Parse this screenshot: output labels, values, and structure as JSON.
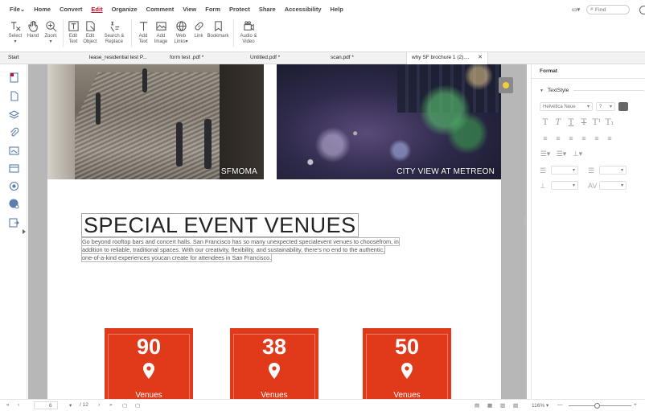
{
  "menu": {
    "items": [
      "File",
      "Home",
      "Convert",
      "Edit",
      "Organize",
      "Comment",
      "View",
      "Form",
      "Protect",
      "Share",
      "Accessibility",
      "Help"
    ],
    "active": "Edit",
    "find_placeholder": "Find"
  },
  "toolbar": {
    "select": "Select\n▾",
    "hand": "Hand",
    "zoom": "Zoom\n▾",
    "edit_text": "Edit\nText",
    "edit_object": "Edit\nObject",
    "search_replace": "Search &\nReplace",
    "add_text": "Add\nText",
    "add_image": "Add\nImage",
    "web_links": "Web\nLinks▾",
    "link": "Link",
    "bookmark": "Bookmark",
    "audio_video": "Audio &\nVideo"
  },
  "tabs": [
    "Start",
    "lease_residential test P...",
    "form test .pdf *",
    "Untitled.pdf *",
    "scan.pdf *",
    "why SF brochure 1 (2)...."
  ],
  "active_tab_index": 5,
  "document": {
    "photo_captions": [
      "SFMOMA",
      "CITY VIEW AT METREON"
    ],
    "headline": "SPECIAL EVENT VENUES",
    "body_lines": [
      "Go beyond rooftop bars and concert halls. San Francisco has so many unexpected specialevent venues to choosefrom, in",
      "addition to reliable, traditional spaces. With our creativity, flexibility, and sustainability, there's no end to the authentic,",
      "one-of-a-kind experiences youcan create for attendees in San Francisco."
    ],
    "stats": [
      {
        "number": "90",
        "label": "Venues"
      },
      {
        "number": "38",
        "label": "Venues"
      },
      {
        "number": "50",
        "label": "Venues"
      }
    ],
    "stat_color": "#e13a1a"
  },
  "right_panel": {
    "tab": "Format",
    "section": "TextStyle",
    "font": "Helvetica Neue",
    "size": "?",
    "text_color": "#666666"
  },
  "statusbar": {
    "page": "6",
    "total": "/ 12",
    "zoom": "116%"
  }
}
